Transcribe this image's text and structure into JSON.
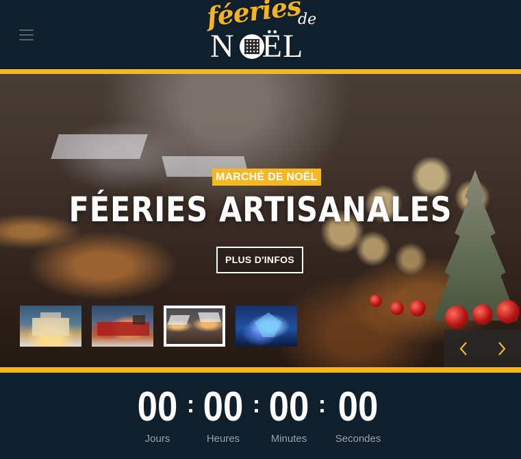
{
  "header": {
    "menu_icon": "hamburger-menu-icon",
    "logo": {
      "script_text": "féeries",
      "de_text": "de",
      "main_text_left": "N",
      "main_text_right": "ËL",
      "emblem": "qr-code-icon",
      "colors": {
        "script": "#f5b323",
        "main": "#ffffff"
      }
    }
  },
  "hero": {
    "badge": "MARCHÉ DE NOËL",
    "title": "FÉERIES ARTISANALES",
    "button_label": "PLUS D'INFOS",
    "thumbnails": [
      {
        "name": "thumb-castle-snow",
        "active": false
      },
      {
        "name": "thumb-christmas-train",
        "active": false
      },
      {
        "name": "thumb-christmas-market",
        "active": true
      },
      {
        "name": "thumb-dragon-lights",
        "active": false
      }
    ],
    "prev_icon": "chevron-left-icon",
    "next_icon": "chevron-right-icon",
    "accent_color": "#f5b823"
  },
  "countdown": {
    "units": [
      {
        "value": "00",
        "label": "Jours"
      },
      {
        "value": "00",
        "label": "Heures"
      },
      {
        "value": "00",
        "label": "Minutes"
      },
      {
        "value": "00",
        "label": "Secondes"
      }
    ],
    "separator": ":"
  },
  "colors": {
    "background": "#0f1f2c",
    "accent": "#f5b823",
    "label": "#9aa3ab"
  }
}
